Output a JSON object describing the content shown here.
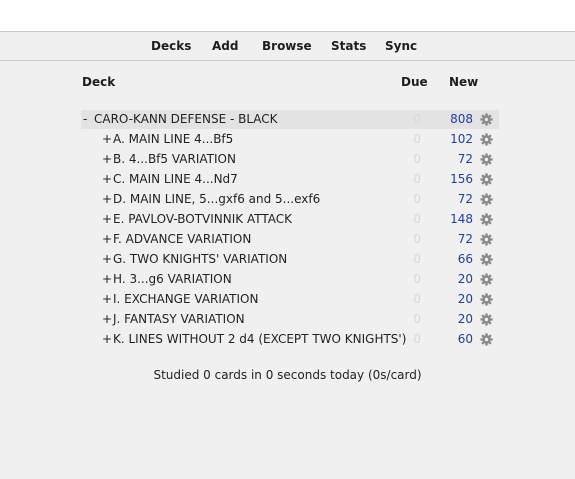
{
  "toolbar": {
    "decks": "Decks",
    "add": "Add",
    "browse": "Browse",
    "stats": "Stats",
    "sync": "Sync"
  },
  "table": {
    "headers": {
      "deck": "Deck",
      "due": "Due",
      "new": "New"
    },
    "rows": [
      {
        "expander": "-",
        "name": "CARO-KANN DEFENSE - BLACK",
        "due": "0",
        "new": "808",
        "icon": "gear-icon"
      },
      {
        "expander": "+",
        "name": "A. MAIN LINE 4...Bf5",
        "due": "0",
        "new": "102",
        "icon": "gear-icon"
      },
      {
        "expander": "+",
        "name": "B. 4...Bf5 VARIATION",
        "due": "0",
        "new": "72",
        "icon": "gear-icon"
      },
      {
        "expander": "+",
        "name": "C. MAIN LINE 4...Nd7",
        "due": "0",
        "new": "156",
        "icon": "gear-icon"
      },
      {
        "expander": "+",
        "name": "D. MAIN LINE, 5...gxf6 and 5...exf6",
        "due": "0",
        "new": "72",
        "icon": "gear-icon"
      },
      {
        "expander": "+",
        "name": "E. PAVLOV-BOTVINNIK ATTACK",
        "due": "0",
        "new": "148",
        "icon": "gear-icon"
      },
      {
        "expander": "+",
        "name": "F. ADVANCE VARIATION",
        "due": "0",
        "new": "72",
        "icon": "gear-icon"
      },
      {
        "expander": "+",
        "name": "G. TWO KNIGHTS' VARIATION",
        "due": "0",
        "new": "66",
        "icon": "gear-icon"
      },
      {
        "expander": "+",
        "name": "H. 3...g6 VARIATION",
        "due": "0",
        "new": "20",
        "icon": "gear-icon"
      },
      {
        "expander": "+",
        "name": "I. EXCHANGE VARIATION",
        "due": "0",
        "new": "20",
        "icon": "gear-icon"
      },
      {
        "expander": "+",
        "name": "J. FANTASY VARIATION",
        "due": "0",
        "new": "20",
        "icon": "gear-icon"
      },
      {
        "expander": "+",
        "name": "K. LINES WITHOUT 2 d4 (EXCEPT TWO KNIGHTS')",
        "due": "0",
        "new": "60",
        "icon": "gear-icon"
      }
    ]
  },
  "footer": {
    "studied": "Studied 0 cards in 0 seconds today (0s/card)"
  },
  "colors": {
    "new_count": "#1f3ea8",
    "due_zero": "#d8d8d8",
    "highlight_row": "#e3e3e3"
  }
}
